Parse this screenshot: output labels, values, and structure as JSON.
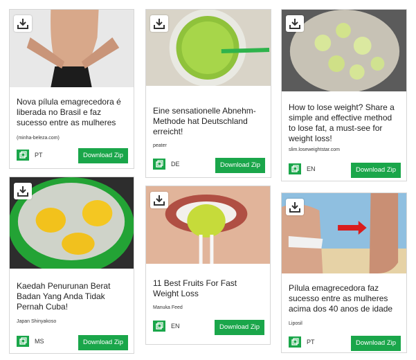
{
  "cards": [
    {
      "title": "Nova pílula emagrecedora é liberada no Brasil e faz sucesso entre as mulheres",
      "source": "(minha-beleza.com)",
      "lang": "PT",
      "button": "Download Zip",
      "image": "woman-belly"
    },
    {
      "title": "Eine sensationelle Abnehm-Methode hat Deutschland erreicht!",
      "source": "peater",
      "lang": "DE",
      "button": "Download Zip",
      "image": "green-juice"
    },
    {
      "title": "How to lose weight? Share a simple and effective method to lose fat, a must-see for weight loss!",
      "source": "slim.loseweightstar.com",
      "lang": "EN",
      "button": "Download Zip",
      "image": "lime-slices-bowl"
    },
    {
      "title": "Kaedah Penurunan Berat Badan Yang Anda Tidak Pernah Cuba!",
      "source": "Japan Shinyakoso",
      "lang": "MS",
      "button": "Download Zip",
      "image": "boiling-eggs-pot"
    },
    {
      "title": "11 Best Fruits For Fast Weight Loss",
      "source": "Manuka Feed",
      "lang": "EN",
      "button": "Download Zip",
      "image": "kiwi-fork-mouth"
    },
    {
      "title": "Pílula emagrecedora faz sucesso entre as mulheres acima dos 40 anos de idade",
      "source": "Liposil",
      "lang": "PT",
      "button": "Download Zip",
      "image": "before-after-body"
    }
  ],
  "icons": {
    "download": "download-icon",
    "language": "copy-icon"
  },
  "colors": {
    "accent": "#1aa64a"
  }
}
